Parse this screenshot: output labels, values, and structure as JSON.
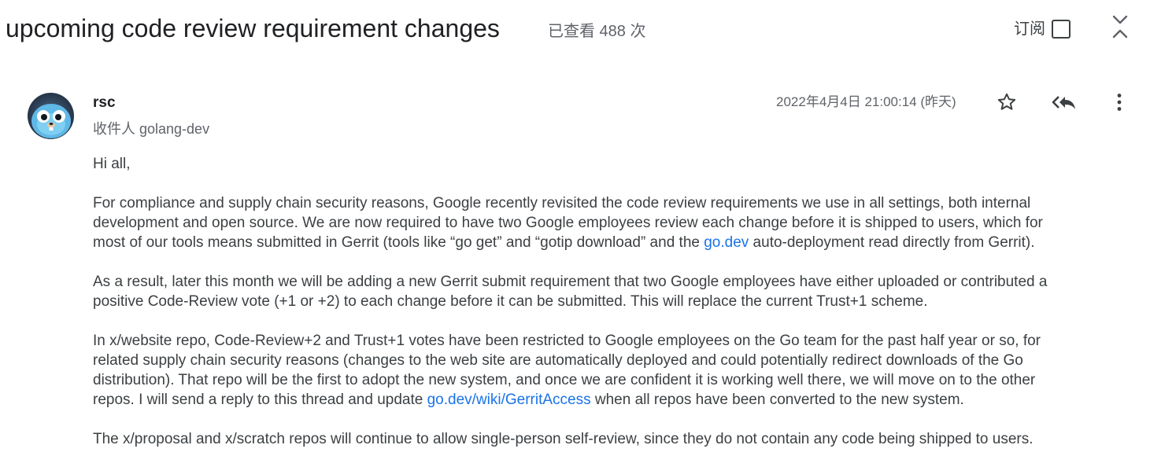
{
  "thread": {
    "title": "upcoming code review requirement changes",
    "views": "已查看 488 次",
    "subscribe_label": "订阅"
  },
  "message": {
    "sender": "rsc",
    "recipients": "收件人 golang-dev",
    "timestamp": "2022年4月4日 21:00:14 (昨天)",
    "greeting": "Hi all,",
    "p1": {
      "line1": "For compliance and supply chain security reasons, Google recently revisited the code review requirements we use in all settings, both internal",
      "line2": "development and open source. We are now required to have two Google employees review each change before it is shipped to users, which for",
      "line3_pre": "most of our tools means submitted in Gerrit (tools like “go get” and “gotip download” and the ",
      "link": "go.dev",
      "line3_post": " auto-deployment read directly from Gerrit)."
    },
    "p2": {
      "line1": "As a result, later this month we will be adding a new Gerrit submit requirement that two Google employees have either uploaded or contributed a",
      "line2": "positive Code-Review vote (+1 or +2) to each change before it can be submitted. This will replace the current Trust+1 scheme."
    },
    "p3": {
      "line1": "In x/website repo, Code-Review+2 and Trust+1 votes have been restricted to Google employees on the Go team for the past half year or so, for",
      "line2": "related supply chain security reasons (changes to the web site are automatically deployed and could potentially redirect downloads of the Go",
      "line3": "distribution). That repo will be the first to adopt the new system, and once we are confident it is working well there, we will move on to the other",
      "line4_pre": "repos. I will send a reply to this thread and update ",
      "link": "go.dev/wiki/GerritAccess",
      "line4_post": " when all repos have been converted to the new system."
    },
    "p4": {
      "line1": "The x/proposal and x/scratch repos will continue to allow single-person self-review, since they do not contain any code being shipped to users."
    }
  },
  "icons": {
    "collapse": "unfold-less-icon",
    "star": "star-outline-icon",
    "reply_all": "reply-all-icon",
    "more": "more-vert-icon",
    "avatar": "gopher-avatar"
  },
  "colors": {
    "link": "#1a73e8",
    "text": "#3c4043",
    "secondary": "#5f6368"
  }
}
